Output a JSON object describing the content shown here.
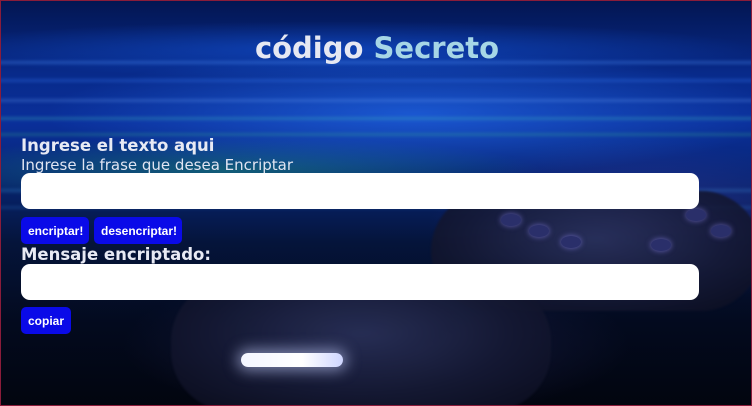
{
  "header": {
    "title_part1": "código",
    "title_part2": "Secreto"
  },
  "input_section": {
    "heading": "Ingrese el texto aqui",
    "subheading": "Ingrese la frase que desea Encriptar",
    "input_value": ""
  },
  "actions": {
    "encrypt_label": "encriptar!",
    "decrypt_label": "desencriptar!"
  },
  "output_section": {
    "heading": "Mensaje encriptado:",
    "output_value": "",
    "copy_label": "copiar"
  },
  "colors": {
    "button_bg": "#0a0ae8",
    "title_accent": "#a6d6e6",
    "title_main": "#e6e8f2"
  }
}
